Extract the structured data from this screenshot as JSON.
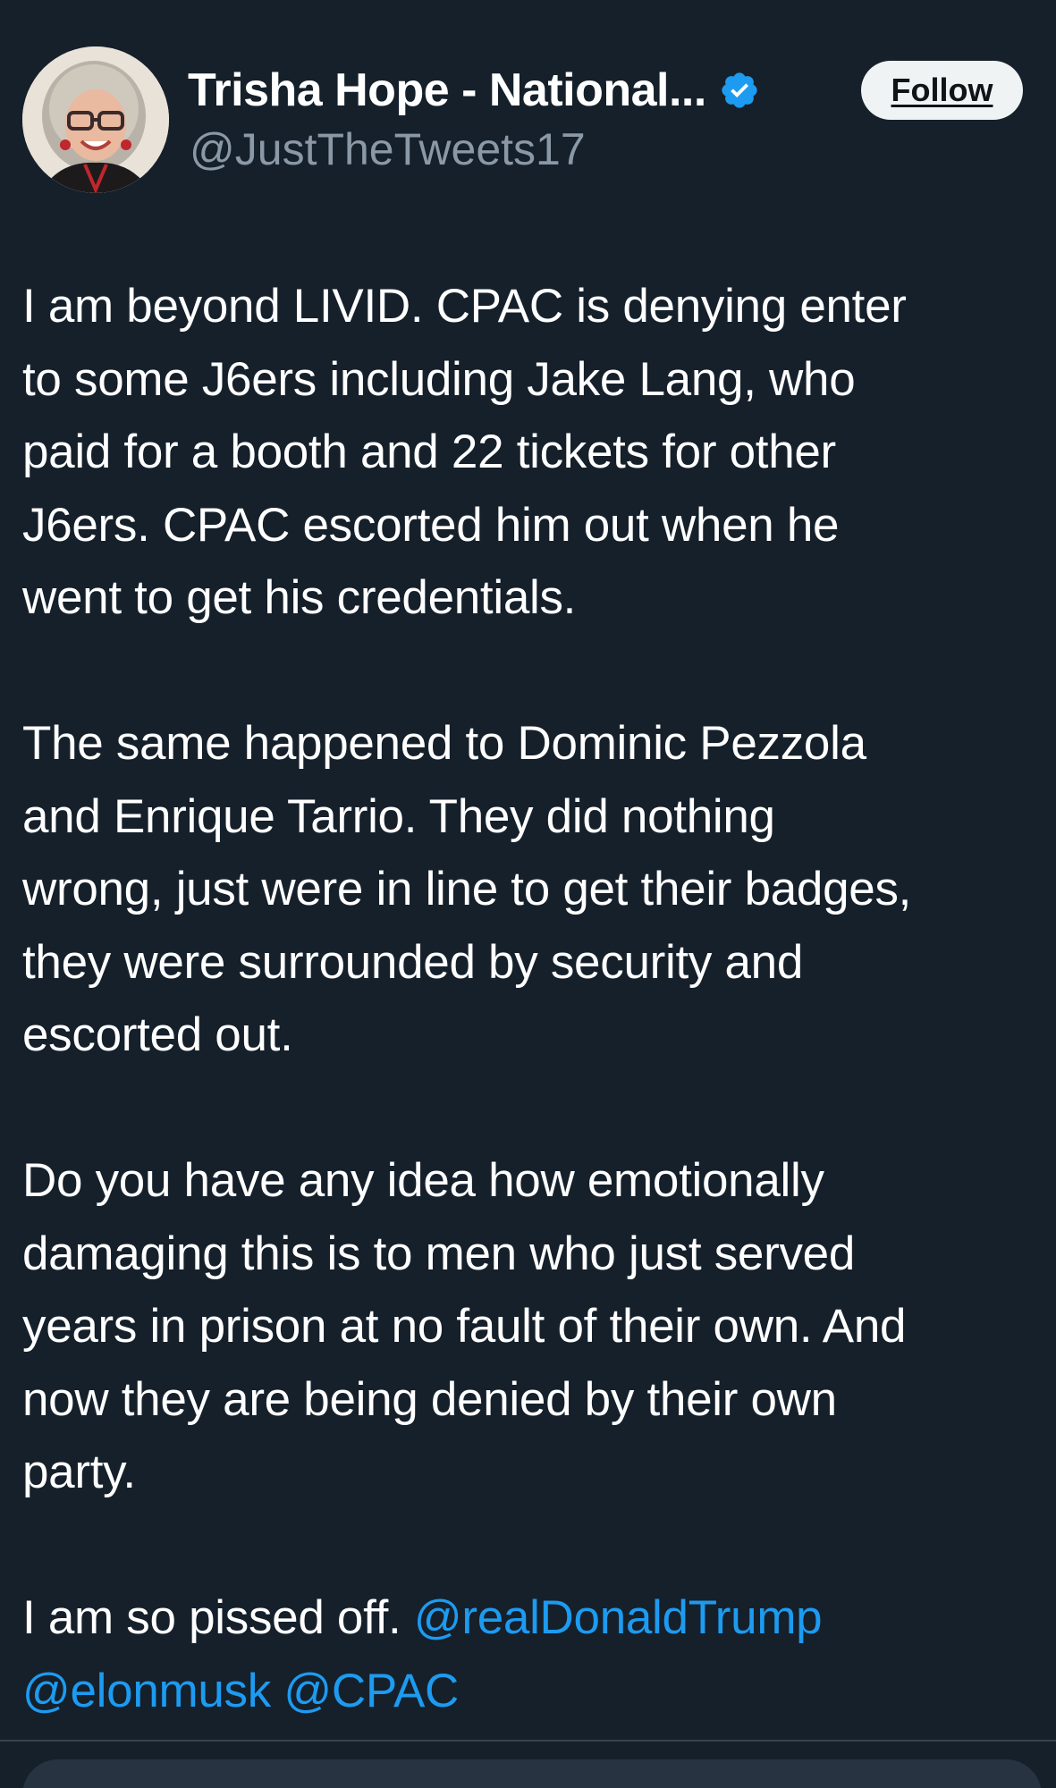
{
  "author": {
    "display_name": "Trisha Hope - National...",
    "handle": "@JustTheTweets17",
    "verified_icon": "verified-badge-icon",
    "avatar_icon": "avatar-photo"
  },
  "follow_label": "Follow",
  "tweet": {
    "paragraphs": [
      {
        "text": "I am beyond LIVID.  CPAC is denying enter\nto some J6ers including Jake Lang, who\npaid for a booth and 22 tickets for other\nJ6ers.  CPAC escorted him out when he\nwent to get his credentials."
      },
      {
        "text": "The same happened to Dominic Pezzola\nand Enrique Tarrio.  They did nothing\nwrong, just were in line to get their badges,\nthey were surrounded by security and\nescorted out."
      },
      {
        "text": "Do you have any idea how emotionally\ndamaging this is to men who just served\nyears in prison at no fault of their own.  And\nnow they are being denied by their own\nparty."
      }
    ],
    "last_paragraph": {
      "text": "I am so pissed off. ",
      "mention_1": "@realDonaldTrump",
      "mention_2": "@elonmusk",
      "mention_3": "@CPAC"
    }
  },
  "colors": {
    "background": "#15202b",
    "text": "#ffffff",
    "secondary_text": "#8b98a5",
    "link": "#1d9bf0",
    "verified": "#1d9bf0",
    "follow_bg": "#eff3f4"
  }
}
